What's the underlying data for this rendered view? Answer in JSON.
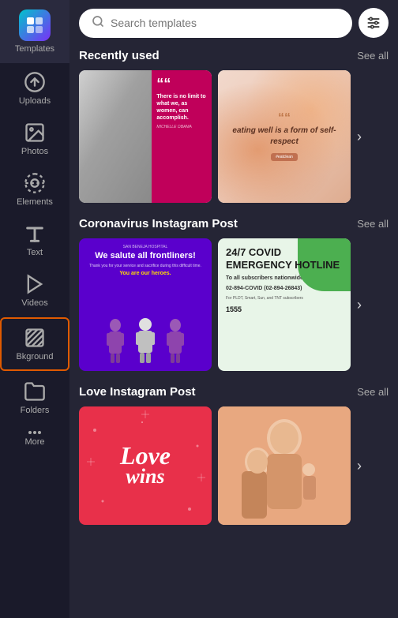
{
  "sidebar": {
    "app_name": "Templates",
    "items": [
      {
        "id": "templates",
        "label": "Templates",
        "active": true
      },
      {
        "id": "uploads",
        "label": "Uploads",
        "active": false
      },
      {
        "id": "photos",
        "label": "Photos",
        "active": false
      },
      {
        "id": "elements",
        "label": "Elements",
        "active": false
      },
      {
        "id": "text",
        "label": "Text",
        "active": false
      },
      {
        "id": "videos",
        "label": "Videos",
        "active": false
      },
      {
        "id": "background",
        "label": "Bkground",
        "active": false,
        "highlighted": true
      },
      {
        "id": "folders",
        "label": "Folders",
        "active": false
      },
      {
        "id": "more",
        "label": "More",
        "active": false
      }
    ]
  },
  "search": {
    "placeholder": "Search templates"
  },
  "sections": [
    {
      "id": "recently-used",
      "title": "Recently used",
      "see_all": "See all",
      "cards": [
        {
          "id": "card-quote-limit",
          "quote_mark": "““",
          "text": "There is no limit to what we, as women, can accomplish.",
          "author": "MICHELLE OBAMA"
        },
        {
          "id": "card-eating-well",
          "quote_mark": "““",
          "text": "eating well is a form of self-respect"
        }
      ]
    },
    {
      "id": "coronavirus",
      "title": "Coronavirus Instagram Post",
      "see_all": "See all",
      "cards": [
        {
          "id": "card-frontliners",
          "hospital": "SAN BENEJA HOSPITAL",
          "title": "We salute all frontliners!",
          "subtitle": "Thank you for your service and sacrifice during this difficult time.",
          "tagline": "You are our heroes."
        },
        {
          "id": "card-hotline",
          "title": "24/7 COVID EMERGENCY HOTLINE",
          "number": "02-894-COVID (02-894-26843)",
          "info": "To all subscribers nationwide",
          "alt_number": "1555",
          "alt_info": "For PLDT, Smart, Sun, and TNT subscribers"
        }
      ]
    },
    {
      "id": "love",
      "title": "Love Instagram Post",
      "see_all": "See all",
      "cards": [
        {
          "id": "card-love-wins",
          "script": "Love wins",
          "sub": ""
        },
        {
          "id": "card-love-photo",
          "description": "Family photo"
        }
      ]
    }
  ],
  "chevron": "›"
}
